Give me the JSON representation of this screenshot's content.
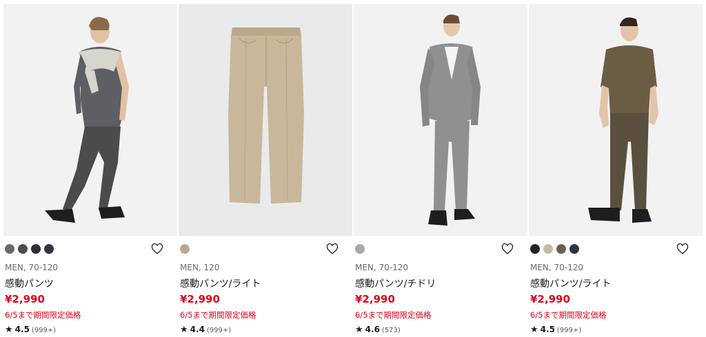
{
  "products": [
    {
      "swatches": [
        "#6b6b6b",
        "#4a4d52",
        "#2c2f33",
        "#2f3640"
      ],
      "meta": "MEN, 70-120",
      "name": "感動パンツ",
      "price": "¥2,990",
      "promo": "6/5まで期間限定価格",
      "rating": "4.5",
      "reviews": "(999+)",
      "image": "model-grey-shirt-grey-pants",
      "pants_color": "#4b4b4d",
      "top_color": "#5d5f62"
    },
    {
      "swatches": [
        "#b9a890"
      ],
      "meta": "MEN, 120",
      "name": "感動パンツ/ライト",
      "price": "¥2,990",
      "promo": "6/5まで期間限定価格",
      "rating": "4.4",
      "reviews": "(999+)",
      "image": "flat-beige-pants",
      "pants_color": "#c8b79a",
      "top_color": ""
    },
    {
      "swatches": [
        "#a7a9aa"
      ],
      "meta": "MEN, 70-120",
      "name": "感動パンツ/チドリ",
      "price": "¥2,990",
      "promo": "6/5まで期間限定価格",
      "rating": "4.6",
      "reviews": "(573)",
      "image": "model-grey-suit",
      "pants_color": "#8f9092",
      "top_color": "#8f9092"
    },
    {
      "swatches": [
        "#1f2428",
        "#c7b8a1",
        "#6d5f4f",
        "#2f3540"
      ],
      "meta": "MEN, 70-120",
      "name": "感動パンツ/ライト",
      "price": "¥2,990",
      "promo": "6/5まで期間限定価格",
      "rating": "4.5",
      "reviews": "(999+)",
      "image": "model-olive-polo-olive-pants",
      "pants_color": "#5b5040",
      "top_color": "#6b5c44"
    }
  ],
  "icons": {
    "favorite": "heart-outline-icon",
    "rating": "star-icon"
  },
  "colors": {
    "price": "#e2001a",
    "background_photo": "#f2f2f2",
    "background_flat": "#e9eaec"
  }
}
